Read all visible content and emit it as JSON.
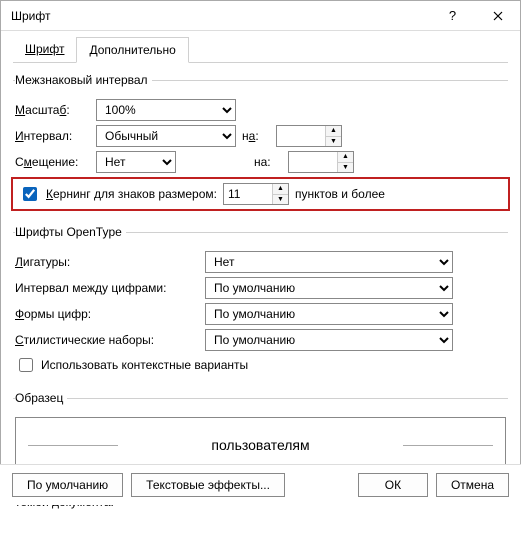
{
  "title": "Шрифт",
  "tabs": {
    "font": "Шрифт",
    "advanced": "Дополнительно"
  },
  "spacing": {
    "legend": "Межзнаковый интервал",
    "scale_label": "Масштаб:",
    "scale_value": "100%",
    "interval_label": "Интервал:",
    "interval_value": "Обычный",
    "interval_by": "на:",
    "position_label": "Смещение:",
    "position_value": "Нет",
    "position_by": "на:",
    "kerning_label": "Кернинг для знаков размером:",
    "kerning_value": "11",
    "kerning_suffix": "пунктов и более"
  },
  "opentype": {
    "legend": "Шрифты OpenType",
    "ligatures_label": "Лигатуры:",
    "ligatures_value": "Нет",
    "numspacing_label": "Интервал между цифрами:",
    "numspacing_value": "По умолчанию",
    "numforms_label": "Формы цифр:",
    "numforms_value": "По умолчанию",
    "stylistic_label": "Стилистические наборы:",
    "stylistic_value": "По умолчанию",
    "context_label": "Использовать контекстные варианты"
  },
  "sample": {
    "legend": "Образец",
    "text": "пользователям",
    "desc": "Шрифт темы для основного текста. Используемый шрифт определяется текущей темой документа."
  },
  "footer": {
    "default": "По умолчанию",
    "effects": "Текстовые эффекты...",
    "ok": "ОК",
    "cancel": "Отмена"
  }
}
